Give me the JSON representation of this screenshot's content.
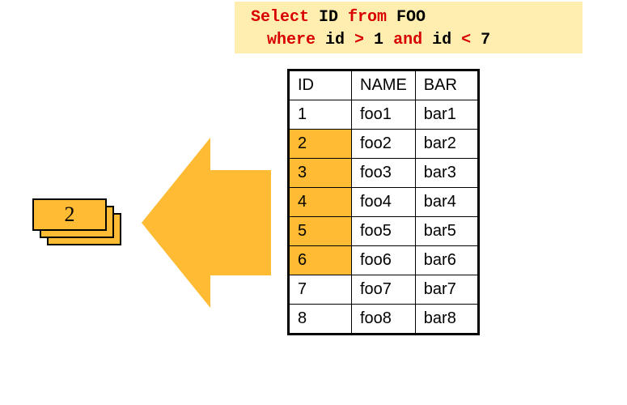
{
  "sql": {
    "line1": {
      "kw1": "Select ",
      "id1": "ID ",
      "kw2": "from ",
      "id2": "FOO"
    },
    "line2": {
      "kw3": "where ",
      "id3": "id ",
      "kw4": "> ",
      "id4": "1 ",
      "kw5": "and ",
      "id5": "id ",
      "kw6": "< ",
      "id6": "7"
    }
  },
  "cardValue": "2",
  "table": {
    "headers": [
      "ID",
      "NAME",
      "BAR"
    ],
    "rows": [
      {
        "cells": [
          "1",
          "foo1",
          "bar1"
        ],
        "hl": [
          false,
          false,
          false
        ]
      },
      {
        "cells": [
          "2",
          "foo2",
          "bar2"
        ],
        "hl": [
          true,
          false,
          false
        ]
      },
      {
        "cells": [
          "3",
          "foo3",
          "bar3"
        ],
        "hl": [
          true,
          false,
          false
        ]
      },
      {
        "cells": [
          "4",
          "foo4",
          "bar4"
        ],
        "hl": [
          true,
          false,
          false
        ]
      },
      {
        "cells": [
          "5",
          "foo5",
          "bar5"
        ],
        "hl": [
          true,
          false,
          false
        ]
      },
      {
        "cells": [
          "6",
          "foo6",
          "bar6"
        ],
        "hl": [
          true,
          false,
          false
        ]
      },
      {
        "cells": [
          "7",
          "foo7",
          "bar7"
        ],
        "hl": [
          false,
          false,
          false
        ]
      },
      {
        "cells": [
          "8",
          "foo8",
          "bar8"
        ],
        "hl": [
          false,
          false,
          false
        ]
      }
    ]
  },
  "colors": {
    "highlight": "#ffbb33",
    "sqlBg": "#ffeeb0",
    "keyword": "#d80000"
  }
}
